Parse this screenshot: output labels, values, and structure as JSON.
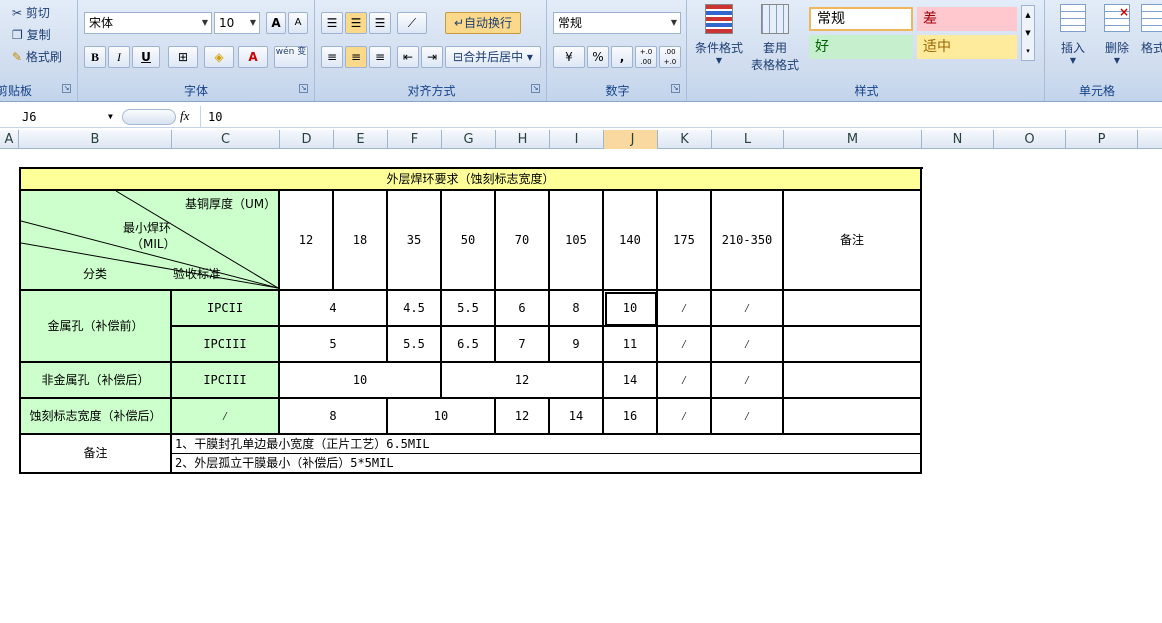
{
  "ribbon": {
    "clipboard": {
      "cut": "剪切",
      "copy": "复制",
      "format_painter": "格式刷",
      "label": "剪贴板"
    },
    "font": {
      "name": "宋体",
      "size": "10",
      "bold": "B",
      "italic": "I",
      "underline": "U",
      "font_color": "A",
      "phonetic": "wén 变",
      "grow": "A",
      "shrink": "A",
      "label": "字体"
    },
    "align": {
      "wrap": "自动换行",
      "merge": "合并后居中",
      "label": "对齐方式"
    },
    "number": {
      "format": "常规",
      "percent": "%",
      "comma": ",",
      "inc": "+.0 .00",
      "dec": ".00 +.0",
      "label": "数字"
    },
    "styles": {
      "conditional": "条件格式",
      "table1": "套用",
      "table2": "表格格式",
      "normal": "常规",
      "bad": "差",
      "good": "好",
      "neutral": "适中",
      "label": "样式"
    },
    "cells": {
      "insert": "插入",
      "delete": "删除",
      "format": "格式",
      "label": "单元格"
    }
  },
  "formula_bar": {
    "name_box": "J6",
    "fx": "fx",
    "value": "10"
  },
  "columns": [
    "A",
    "B",
    "C",
    "D",
    "E",
    "F",
    "G",
    "H",
    "I",
    "J",
    "K",
    "L",
    "M",
    "N",
    "O",
    "P"
  ],
  "selected_column": "J",
  "table": {
    "title": "外层焊环要求（蚀刻标志宽度）",
    "corner": {
      "thickness": "基铜厚度（UM）",
      "min_ring1": "最小焊环",
      "min_ring2": "（MIL）",
      "category": "分类",
      "standard": "验收标准"
    },
    "thickness_headers": [
      "12",
      "18",
      "35",
      "50",
      "70",
      "105",
      "140",
      "175",
      "210-350"
    ],
    "remark_header": "备注",
    "metal_hole": "金属孔（补偿前）",
    "nonmetal_hole": "非金属孔（补偿后）",
    "etch_mark": "蚀刻标志宽度（补偿后）",
    "ipc2": "IPCII",
    "ipc3": "IPCIII",
    "slash": "⁄",
    "r1": [
      "4",
      "4.5",
      "5.5",
      "6",
      "8",
      "10"
    ],
    "r2": [
      "5",
      "5.5",
      "6.5",
      "7",
      "9",
      "11"
    ],
    "r3": [
      "10",
      "12",
      "14"
    ],
    "r4": [
      "8",
      "10",
      "12",
      "14",
      "16"
    ],
    "notes_label": "备注",
    "note1": "1、干膜封孔单边最小宽度（正片工艺）6.5MIL",
    "note2": "2、外层孤立干膜最小（补偿后）5*5MIL"
  }
}
